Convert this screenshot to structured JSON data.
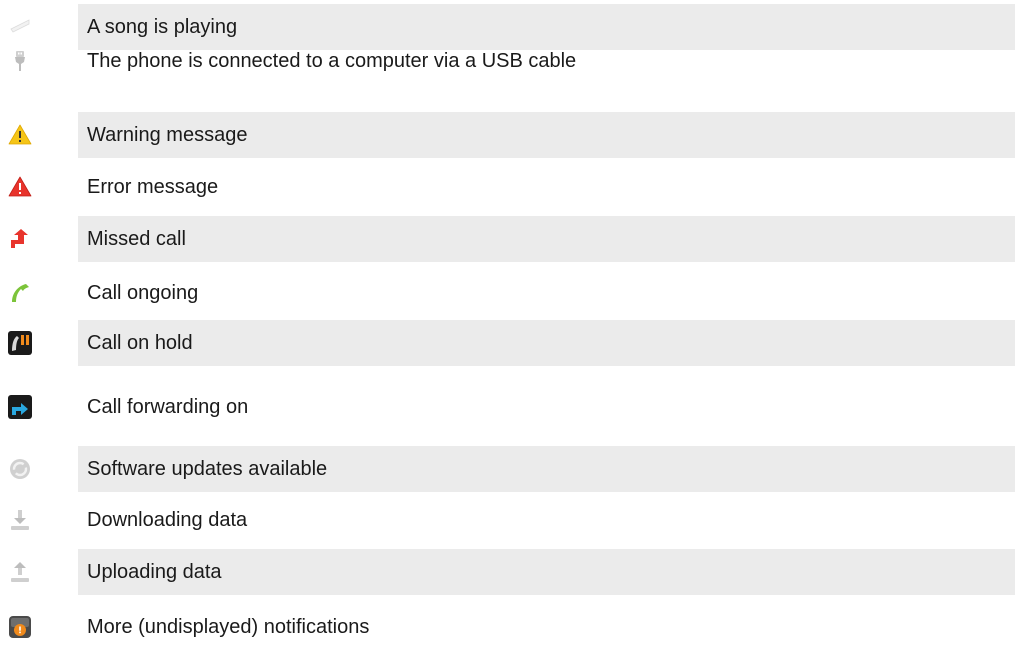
{
  "rows": [
    {
      "icon": "song-playing-icon",
      "text": "A song is playing"
    },
    {
      "icon": "usb-icon",
      "text": "The phone is connected to a computer via a USB cable"
    },
    {
      "icon": "warning-icon",
      "text": "Warning message"
    },
    {
      "icon": "error-icon",
      "text": "Error message"
    },
    {
      "icon": "missed-call-icon",
      "text": "Missed call"
    },
    {
      "icon": "call-ongoing-icon",
      "text": "Call ongoing"
    },
    {
      "icon": "call-on-hold-icon",
      "text": "Call on hold"
    },
    {
      "icon": "call-forwarding-icon",
      "text": "Call forwarding on"
    },
    {
      "icon": "software-update-icon",
      "text": "Software updates available"
    },
    {
      "icon": "download-icon",
      "text": "Downloading data"
    },
    {
      "icon": "upload-icon",
      "text": "Uploading data"
    },
    {
      "icon": "more-notifications-icon",
      "text": "More (undisplayed) notifications"
    }
  ],
  "colors": {
    "row_shade": "#ebebeb",
    "text": "#1a1a1a",
    "warning": "#f5c518",
    "error": "#e8342c",
    "missed_call": "#e8342c",
    "call_ongoing": "#7cc43a",
    "call_forward": "#2aa8e0",
    "hold_accent": "#f08a1c"
  }
}
